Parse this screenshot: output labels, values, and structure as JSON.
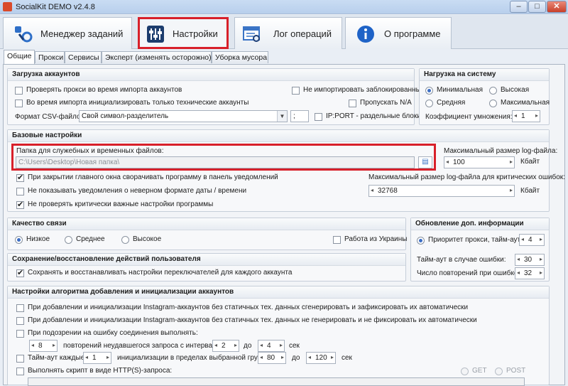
{
  "window": {
    "title": "SocialKit DEMO v2.4.8"
  },
  "main_tabs": [
    {
      "label": "Менеджер заданий"
    },
    {
      "label": "Настройки"
    },
    {
      "label": "Лог операций"
    },
    {
      "label": "О программе"
    }
  ],
  "sub_tabs": [
    "Общие",
    "Прокси",
    "Сервисы",
    "Эксперт (изменять осторожно)",
    "Уборка мусора"
  ],
  "accounts_load": {
    "title": "Загрузка аккаунтов",
    "check_proxy": "Проверять прокси во время импорта аккаунтов",
    "no_import_blocked": "Не импортировать заблокированные",
    "init_technical": "Во время импорта инициализировать только технические аккаунты",
    "skip_na": "Пропускать N/A",
    "csv_format_label": "Формат CSV-файлов:",
    "csv_format_value": "Свой символ-разделитель",
    "separator_value": ";",
    "ipport_label": "IP:PORT - раздельные блоки"
  },
  "system_load": {
    "title": "Нагрузка на систему",
    "min": "Минимальная",
    "high": "Высокая",
    "mid": "Средняя",
    "max": "Максимальная",
    "multiplier_label": "Коэффициент умножения:",
    "multiplier_value": "1"
  },
  "base_settings": {
    "title": "Базовые настройки",
    "folder_label": "Папка для служебных и временных файлов:",
    "folder_value": "C:\\Users\\Desktop\\Новая папка\\",
    "log_size_label": "Максимальный размер log-файла:",
    "log_size_value": "100",
    "log_size_unit": "Кбайт",
    "minimize_tray": "При закрытии главного окна сворачивать программу в панель уведомлений",
    "no_date_warn": "Не показывать уведомления о неверном формате даты / времени",
    "no_check_critical": "Не проверять критически важные настройки программы",
    "crit_log_label": "Максимальный размер log-файла для критических ошибок:",
    "crit_log_value": "32768",
    "crit_log_unit": "Кбайт"
  },
  "connection_quality": {
    "title": "Качество связи",
    "low": "Низкое",
    "mid": "Среднее",
    "high": "Высокое",
    "ukraine": "Работа из Украины"
  },
  "extra_update": {
    "title": "Обновление доп. информации",
    "priority_label": "Приоритет прокси, тайм-аут:",
    "priority_value": "4",
    "timeout_err_label": "Тайм-аут в случае ошибки:",
    "timeout_err_value": "30",
    "retry_label": "Число повторений при ошибке:",
    "retry_value": "32"
  },
  "save_restore": {
    "title": "Сохранение/восстановление действий пользователя",
    "save_toggles": "Сохранять и восстанавливать настройки переключателей для каждого аккаунта"
  },
  "algo": {
    "title": "Настройки алгоритма добавления и инициализации аккаунтов",
    "gen_auto": "При добавлении и инициализации Instagram-аккаунтов без статичных тех. данных сгенерировать и зафиксировать их автоматически",
    "no_gen": "При добавлении и инициализации Instagram-аккаунтов без статичных тех. данных не генерировать и не фиксировать их автоматически",
    "on_conn_error": "При подозрении на ошибку соединения выполнять:",
    "retries_value": "8",
    "retries_text": "повторений неудавшегося запроса с интервалом от",
    "from_value": "2",
    "to_label": "до",
    "to_value": "4",
    "sec": "сек",
    "timeout_every": "Тайм-аут каждые",
    "every_value": "1",
    "init_group_text": "инициализации в пределах выбранной группы от",
    "group_from": "80",
    "group_to_label": "до",
    "group_to": "120",
    "group_sec": "сек",
    "http_script": "Выполнять скрипт в виде HTTP(S)-запроса:",
    "get": "GET",
    "post": "POST"
  },
  "colors": {
    "highlight": "#d8202a",
    "accent": "#3b6dc4"
  },
  "icons": [
    "manager-icon",
    "settings-sliders-icon",
    "log-icon",
    "info-icon"
  ]
}
